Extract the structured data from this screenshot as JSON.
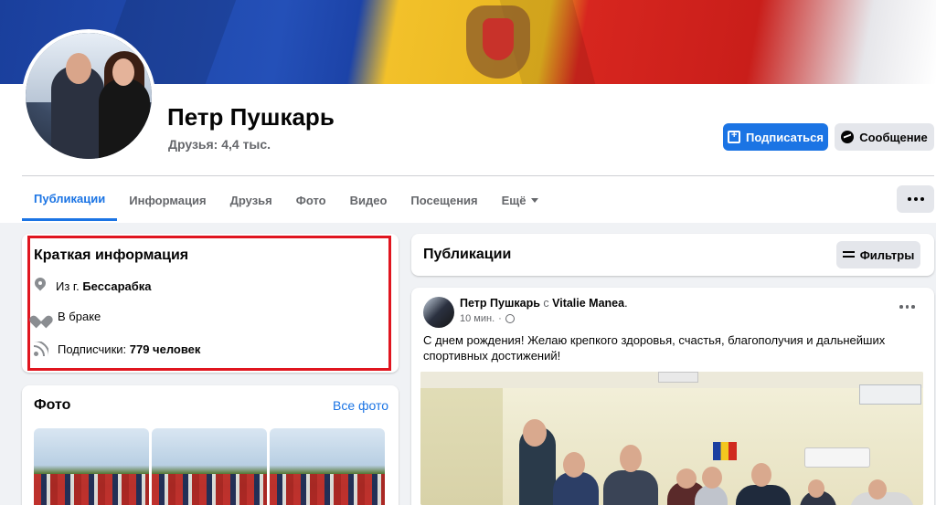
{
  "profile": {
    "name": "Петр Пушкарь",
    "friends": "Друзья: 4,4 тыс."
  },
  "actions": {
    "subscribe_label": "Подписаться",
    "message_label": "Сообщение"
  },
  "tabs": [
    {
      "label": "Публикации",
      "active": true
    },
    {
      "label": "Информация",
      "active": false
    },
    {
      "label": "Друзья",
      "active": false
    },
    {
      "label": "Фото",
      "active": false
    },
    {
      "label": "Видео",
      "active": false
    },
    {
      "label": "Посещения",
      "active": false
    },
    {
      "label": "Ещё",
      "active": false
    }
  ],
  "intro": {
    "title": "Краткая информация",
    "from_prefix": "Из г.",
    "from_value": "Бессарабка",
    "relationship": "В браке",
    "followers_prefix": "Подписчики:",
    "followers_value": "779 человек"
  },
  "photos": {
    "title": "Фото",
    "see_all": "Все фото"
  },
  "posts": {
    "title": "Публикации",
    "filter_label": "Фильтры"
  },
  "post": {
    "author": "Петр Пушкарь",
    "with_word": "с",
    "tagged": "Vitalie Manea",
    "time": "10 мин.",
    "separator": "·",
    "text": "С днем рождения! Желаю крепкого здоровья, счастья, благополучия и дальнейших спортивных достижений!"
  },
  "colors": {
    "accent": "#1b74e4",
    "highlight_border": "#e0151f",
    "background": "#f0f2f5"
  }
}
